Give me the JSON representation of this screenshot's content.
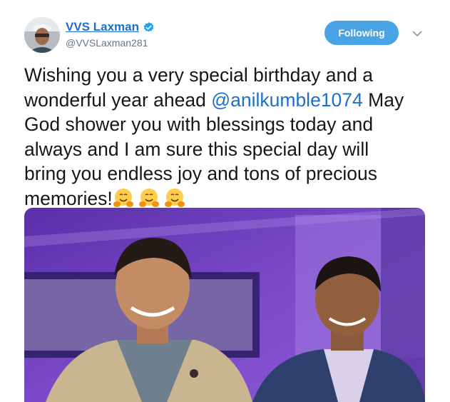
{
  "author": {
    "name": "VVS Laxman",
    "handle": "@VVSLaxman281",
    "verified": true
  },
  "follow_button": {
    "label": "Following"
  },
  "tweet": {
    "line1": "Wishing you a very special birthday and a",
    "line2_before": "wonderful year ahead ",
    "mention": "@anilkumble1074",
    "line2_after": " May",
    "line3": "God shower you with blessings today and",
    "line4": "always and I am sure this special day will",
    "line5": "bring you endless joy and tons of precious",
    "line6": "memories!",
    "emojis": [
      "hugging-face",
      "hugging-face",
      "hugging-face"
    ]
  },
  "colors": {
    "link": "#1f6fc9",
    "follow_button": "#4aa3e5",
    "secondary_text": "#657786",
    "photo_background": "#6a3fb8"
  },
  "icons": [
    "verified-badge-icon",
    "chevron-down-icon",
    "hugging-face-emoji"
  ]
}
